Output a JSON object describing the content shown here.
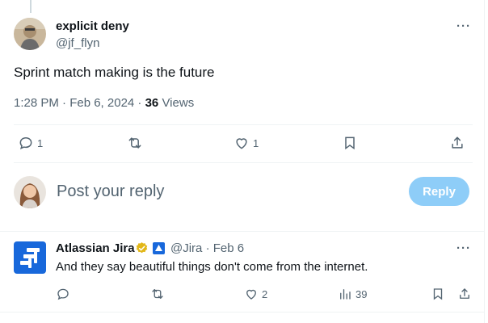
{
  "main_tweet": {
    "author_name": "explicit deny",
    "author_handle": "@jf_flyn",
    "more_label": "···",
    "text": "Sprint match making is the future",
    "time_date": "1:28 PM · Feb 6, 2024 · ",
    "views_count": "36",
    "views_label": " Views",
    "actions": {
      "replies": "1",
      "retweets": "",
      "likes": "1"
    }
  },
  "composer": {
    "placeholder": "Post your reply",
    "reply_button": "Reply"
  },
  "reply_tweet": {
    "author_name": "Atlassian Jira",
    "handle_date": "@Jira · Feb 6",
    "more_label": "···",
    "text": "And they say beautiful things don't come from the internet.",
    "actions": {
      "replies": "",
      "retweets": "",
      "likes": "2",
      "views": "39"
    }
  },
  "colors": {
    "accent": "#1d9bf0",
    "reply_button_disabled": "#8ecdf8",
    "jira_blue": "#1868db",
    "verified_gold": "#e2b719",
    "muted": "#536471"
  }
}
